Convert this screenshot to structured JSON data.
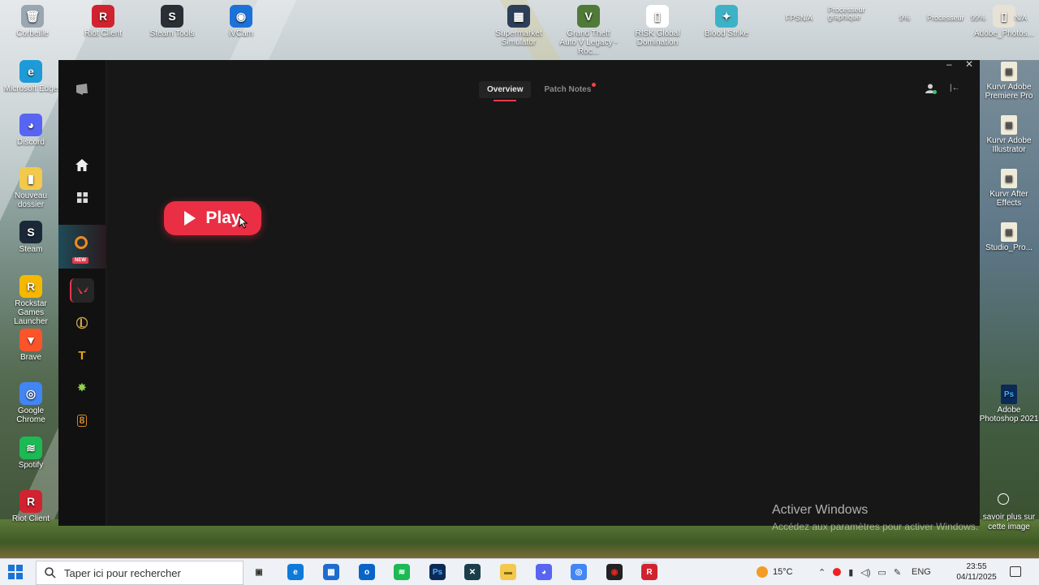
{
  "desktop": {
    "top_icons": [
      {
        "label": "Corbeille",
        "color": "#9aa7b1",
        "glyph": "🗑"
      },
      {
        "label": "Riot Client",
        "color": "#d1232f",
        "glyph": "R"
      },
      {
        "label": "Steam Tools",
        "color": "#2a2f36",
        "glyph": "S"
      },
      {
        "label": "iVCam",
        "color": "#1d72d8",
        "glyph": "◉"
      },
      {
        "label": "Supermarket Simulator",
        "color": "#2d3f58",
        "glyph": "▦"
      },
      {
        "label": "Grand Theft Auto V Legacy - Roc...",
        "color": "#4f7a38",
        "glyph": "V"
      },
      {
        "label": "RISK Global Domination",
        "color": "#ffffff",
        "glyph": "▯"
      },
      {
        "label": "Blood Strike",
        "color": "#3db2c6",
        "glyph": "✦"
      },
      {
        "label": "Adobe_Photos...",
        "color": "#e7e2d5",
        "glyph": "▯"
      }
    ],
    "left_icons": [
      {
        "label": "Microsoft Edge",
        "color": "#1e9bd7",
        "glyph": "e"
      },
      {
        "label": "Discord",
        "color": "#5865f2",
        "glyph": "◕"
      },
      {
        "label": "Nouveau dossier",
        "color": "#f2c94c",
        "glyph": "▮"
      },
      {
        "label": "Steam",
        "color": "#1b2838",
        "glyph": "S"
      },
      {
        "label": "Rockstar Games Launcher",
        "color": "#f5b800",
        "glyph": "R"
      },
      {
        "label": "Brave",
        "color": "#fb542b",
        "glyph": "▼"
      },
      {
        "label": "Google Chrome",
        "color": "#4285f4",
        "glyph": "◎"
      },
      {
        "label": "Spotify",
        "color": "#1db954",
        "glyph": "≋"
      },
      {
        "label": "Riot Client",
        "color": "#d1232f",
        "glyph": "R"
      }
    ],
    "right_icons": [
      {
        "label": "Kurvr Adobe Premiere Pro"
      },
      {
        "label": "Kurvr Adobe Illustrator"
      },
      {
        "label": "Kurvr After Effects"
      },
      {
        "label": "Studio_Pro..."
      },
      {
        "label": "Adobe Photoshop 2021"
      }
    ],
    "overlay": {
      "gpu_label": "Processeur graphique",
      "gpu_value": "9%",
      "fps_label": "FPS",
      "fps_value": "N/A",
      "cpu_label": "Processeur",
      "cpu_value": "99%",
      "na": "N/A"
    },
    "side_hint": {
      "line1": "savoir plus sur",
      "line2": "cette image"
    },
    "activate": {
      "title": "Activer Windows",
      "subtitle": "Accédez aux paramètres pour activer Windows."
    }
  },
  "app": {
    "tabs": [
      {
        "label": "Overview",
        "active": true
      },
      {
        "label": "Patch Notes",
        "active": false,
        "dot": true
      }
    ],
    "play_label": "Play",
    "rail_new_badge": "NEW",
    "accent": "#ea2e43"
  },
  "taskbar": {
    "search_placeholder": "Taper ici pour rechercher",
    "temperature": "15°C",
    "language": "ENG",
    "time": "23:55",
    "date": "04/11/2025"
  }
}
